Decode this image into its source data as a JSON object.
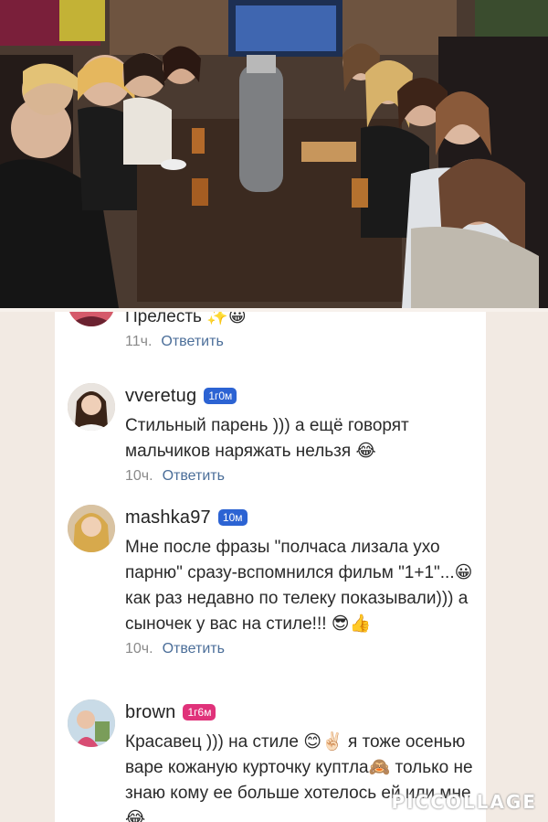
{
  "comments": [
    {
      "username": "",
      "badge": "",
      "text": "Прелесть ✨😀",
      "time": "11ч.",
      "reply_label": "Ответить"
    },
    {
      "username": "vveretug",
      "badge": "1г0м",
      "badge_color": "#2c63d3",
      "text": "Стильный парень ))) а ещё говорят мальчиков наряжать нельзя 😂",
      "time": "10ч.",
      "reply_label": "Ответить"
    },
    {
      "username": "mashka97",
      "badge": "10м",
      "badge_color": "#2c63d3",
      "text": "Мне после фразы \"полчаса лизала ухо парню\" сразу-вспомнился фильм \"1+1\"...😀как раз недавно по телеку показывали))) а сыночек у вас на стиле!!! 😎👍",
      "time": "10ч.",
      "reply_label": "Ответить"
    },
    {
      "username": "brown",
      "badge": "1г6м",
      "badge_color": "#e0327a",
      "text": "Красавец )))  на стиле 😊✌🏻 я тоже осенью варе кожаную курточку куптла🙈 только не знаю кому ее больше хотелось ей или мне 😂",
      "time": "",
      "reply_label": ""
    }
  ],
  "watermark": "PICCOLLAGE"
}
